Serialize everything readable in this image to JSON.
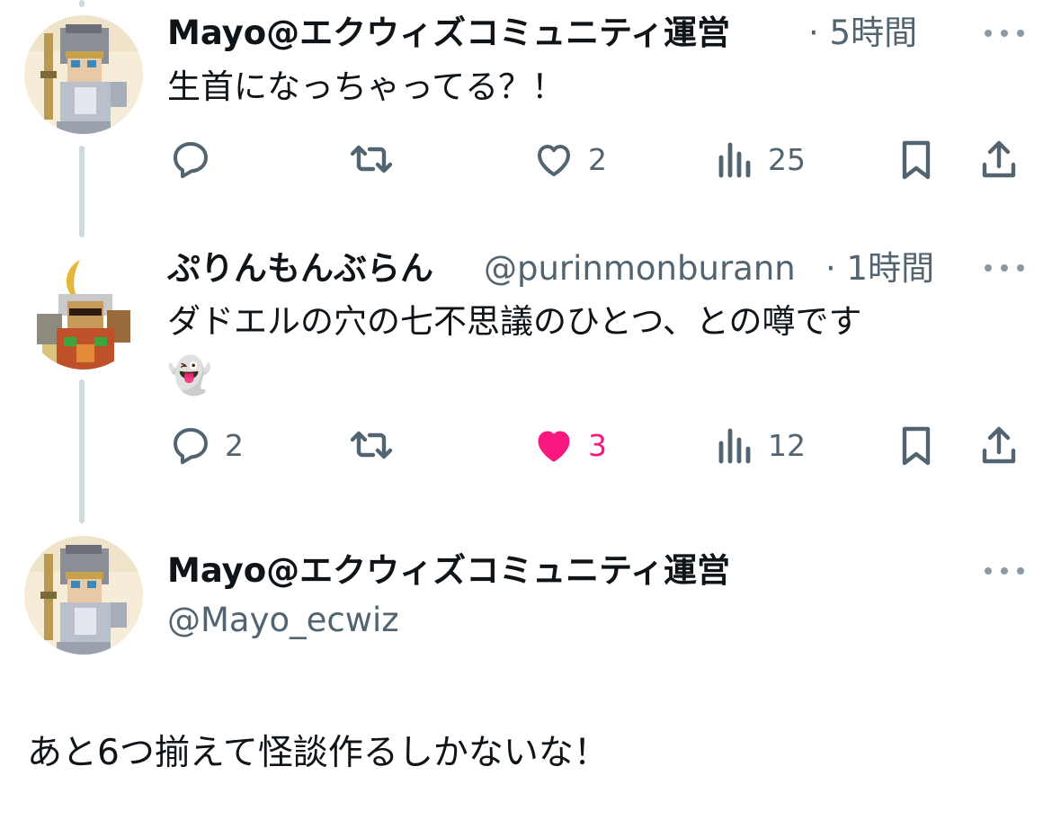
{
  "tweets": [
    {
      "name": "Mayo@エクウィズコミュニティ運営",
      "time_separator": "·",
      "time": "5時間",
      "text": "生首になっちゃってる？！",
      "stats": {
        "replies": "",
        "retweets": "",
        "likes": "2",
        "views": "25"
      },
      "liked": false
    },
    {
      "name": "ぷりんもんぶらん",
      "handle": "@purinmonburann",
      "time_separator": "·",
      "time": "1時間",
      "text": "ダドエルの穴の七不思議のひとつ、との噂です",
      "text_line2": "👻",
      "stats": {
        "replies": "2",
        "retweets": "",
        "likes": "3",
        "views": "12"
      },
      "liked": true
    }
  ],
  "main_tweet": {
    "name": "Mayo@エクウィズコミュニティ運営",
    "handle": "@Mayo_ecwiz",
    "text": "あと6つ揃えて怪談作るしかないな！"
  },
  "colors": {
    "text": "#0f1419",
    "secondary": "#536471",
    "like": "#f91880",
    "thread_line": "#cfd9de"
  },
  "icons": [
    "reply-icon",
    "retweet-icon",
    "like-icon",
    "views-icon",
    "bookmark-icon",
    "share-icon",
    "more-icon"
  ]
}
